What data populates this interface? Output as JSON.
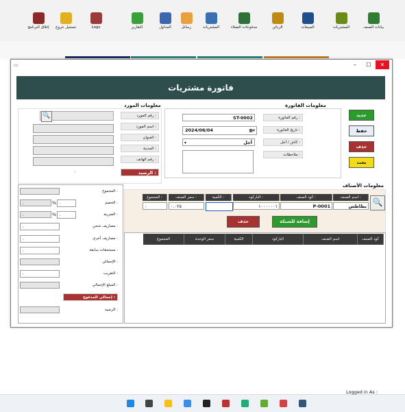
{
  "ribbon": {
    "items": [
      {
        "label": "بيانات الصنف",
        "icon": "items-icon",
        "color": "#2f7d32"
      },
      {
        "label": "المشتريات",
        "icon": "purchases-icon",
        "color": "#6a8a1a"
      },
      {
        "label": "المبيعات",
        "icon": "sales-icon",
        "color": "#1f4e8c"
      },
      {
        "label": "الزبائن",
        "icon": "customers-icon",
        "color": "#c08a10"
      },
      {
        "label": "مدفوعات العملاء",
        "icon": "payments-icon",
        "color": "#2f6f3a"
      },
      {
        "label": "المشتريات",
        "icon": "reports-icon",
        "color": "#3a6fb0"
      },
      {
        "label": "رسائل",
        "icon": "mail-icon",
        "color": "#e8a040"
      },
      {
        "label": "الجداول",
        "icon": "table-icon",
        "color": "#3a67b0"
      },
      {
        "label": "التقارير",
        "icon": "chart-icon",
        "color": "#3aa03a"
      },
      {
        "label": "Logs",
        "icon": "logs-icon",
        "color": "#9a3a3a"
      },
      {
        "label": "تسجيل خروج",
        "icon": "lock-icon",
        "color": "#e0b020"
      },
      {
        "label": "إغلاق البرنامج",
        "icon": "exit-icon",
        "color": "#8a2a2a"
      }
    ]
  },
  "window": {
    "title": "فاتورة مشتريات",
    "min": "–",
    "max": "☐",
    "close": "✕"
  },
  "invoice": {
    "section": "معلومات الفاتورة",
    "number_label": "رقم الفاتورة :",
    "number": "ST-0002",
    "date_label": "تاريخ الفاتورة :",
    "date": "2024/06/04",
    "payment_label": "كاش / أجل :",
    "payment": "أجل",
    "notes_label": "ملاحظات :"
  },
  "actions": {
    "new": "جديد",
    "save": "حفظ",
    "delete": "حذف",
    "search": "بحث"
  },
  "supplier": {
    "section": "معلومات المورد",
    "labels": [
      "رقم المورد :",
      "اسم المورد :",
      "العنوان :",
      "المدينة :",
      "رقم الهاتف :"
    ],
    "balance_label": "الرصيد :",
    "balance_value": "٠"
  },
  "items": {
    "section": "معلومات الأصناف",
    "headers": [
      "اسم الصنف :",
      "كود الصنف :",
      "الباركود :",
      "الكمية :",
      "سعر الصنف :",
      "المجموع :"
    ],
    "name": "بطاطس",
    "code": "P-0001",
    "barcode": "١٠٠٠٠٠٠١",
    "quantity": "",
    "price": "٠.٠٢٥",
    "total": "٠",
    "add_button": "إضافة للشبكة",
    "delete_button": "حذف"
  },
  "grid": {
    "headers": [
      "كود الصنف",
      "اسم الصنف",
      "الباركود",
      "الكمية",
      "سعر الوحدة",
      "المجموع"
    ]
  },
  "totals": {
    "labels": [
      "المجموع :",
      "الخصم :",
      "الضريبة :",
      "مصاريف شحن :",
      "مصاريف أخرى :",
      "مستحقات سابقة :",
      "الإجمالي :",
      "التقريب :",
      "المبلغ الإجمالي :",
      "إجمالي المدفوع :",
      "الرصيد :"
    ],
    "discount": "٠",
    "tax": "٠",
    "shipping": "٠",
    "other": "٠",
    "previous": "٠",
    "rounding": "٠",
    "percent": "%"
  },
  "status": {
    "logged": "Logged in As :"
  }
}
